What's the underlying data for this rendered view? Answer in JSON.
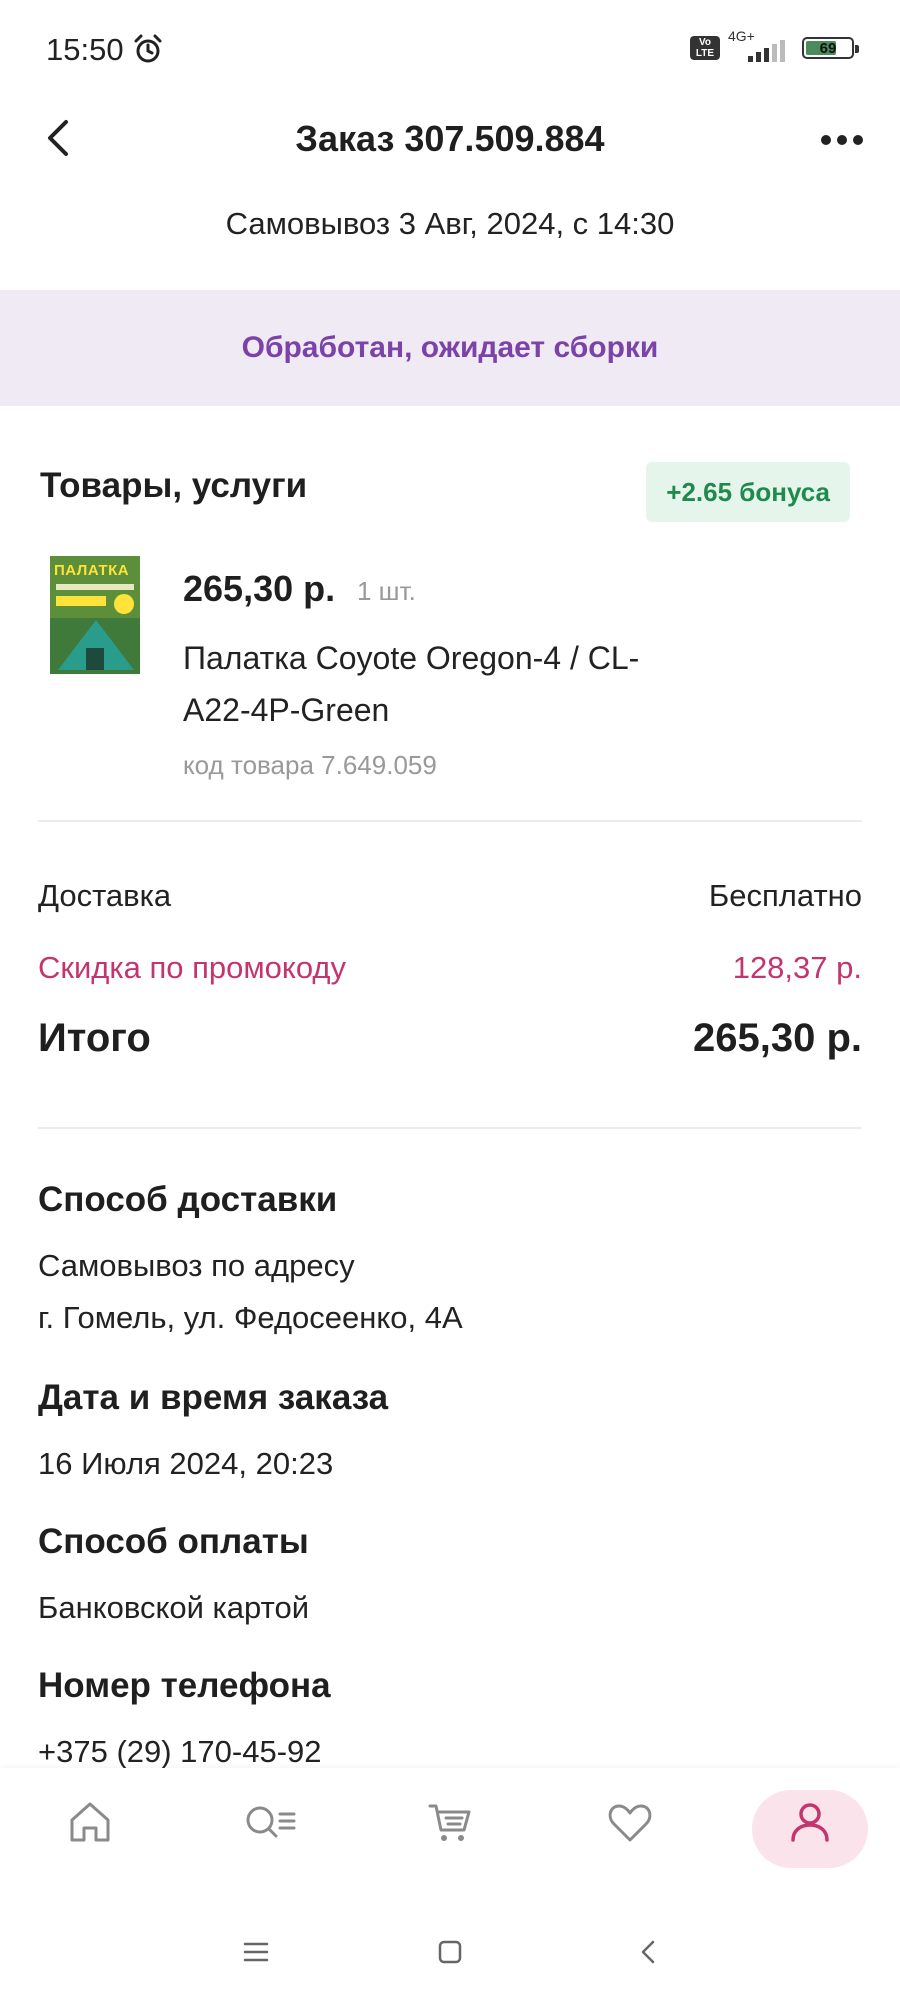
{
  "status_bar": {
    "time": "15:50",
    "network_type": "4G+",
    "volte_label": "Vo LTE",
    "battery_level": "69",
    "battery_fraction": 0.69,
    "icons": [
      "alarm-icon",
      "volte-icon",
      "signal-icon",
      "battery-icon"
    ]
  },
  "header": {
    "title": "Заказ 307.509.884",
    "back_icon": "chevron-left-icon",
    "more_icon": "more-horizontal-icon"
  },
  "pickup_line": "Самовывоз 3 Авг, 2024, с 14:30",
  "order_status": "Обработан, ожидает сборки",
  "goods": {
    "heading": "Товары, услуги",
    "bonus_badge": "+2.65 бонуса",
    "items": [
      {
        "price": "265,30 р.",
        "quantity": "1 шт.",
        "name": "Палатка Coyote Oregon-4 / CL-A22-4P-Green",
        "code": "код товара 7.649.059",
        "image_title": "ПАЛАТКА"
      }
    ]
  },
  "summary": {
    "delivery_label": "Доставка",
    "delivery_value": "Бесплатно",
    "promo_label": "Скидка по промокоду",
    "promo_value": "128,37 р.",
    "total_label": "Итого",
    "total_value": "265,30 р."
  },
  "details": {
    "delivery_method_label": "Способ доставки",
    "delivery_method_line1": "Самовывоз по адресу",
    "delivery_method_line2": "г. Гомель, ул. Федосеенко, 4А",
    "order_date_label": "Дата и время заказа",
    "order_date_value": "16 Июля 2024, 20:23",
    "payment_label": "Способ оплаты",
    "payment_value": "Банковской картой",
    "phone_label": "Номер телефона",
    "phone_value": "+375 (29) 170-45-92"
  },
  "bottom_nav": {
    "items": [
      "home-icon",
      "catalog-search-icon",
      "cart-icon",
      "favorites-icon",
      "profile-icon"
    ],
    "active": "profile-icon"
  },
  "system_nav": {
    "items": [
      "recents-icon",
      "home-square-icon",
      "back-icon"
    ]
  },
  "colors": {
    "status_banner_bg": "#f0eaf5",
    "status_banner_text": "#7b43a8",
    "bonus_bg": "#e6f5ec",
    "bonus_text": "#1f8a4e",
    "promo_text": "#c4356f",
    "nav_active_bg": "#fbe3ec",
    "nav_active_icon": "#c4356f",
    "nav_icon": "#8a8a8a"
  }
}
